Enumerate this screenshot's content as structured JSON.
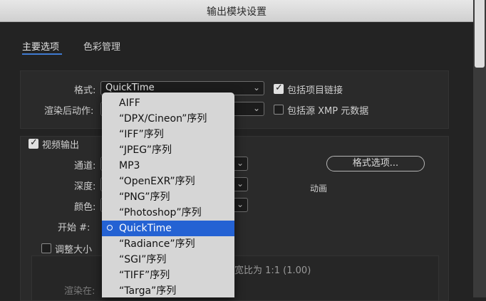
{
  "window": {
    "title": "输出模块设置"
  },
  "tabs": [
    {
      "label": "主要选项"
    },
    {
      "label": "色彩管理"
    }
  ],
  "format": {
    "label": "格式:",
    "value": "QuickTime",
    "include_project_link": "包括项目链接",
    "include_project_link_checked": true
  },
  "post_render": {
    "label": "渲染后动作:",
    "include_xmp": "包括源 XMP 元数据",
    "include_xmp_checked": false
  },
  "video_output": {
    "label": "视频输出",
    "checked": true,
    "channel_label": "通道:",
    "depth_label": "深度:",
    "color_label": "颜色:",
    "start_label": "开始 #:",
    "format_options_button": "格式选项...",
    "animation_text": "动画"
  },
  "resize": {
    "label": "调整大小",
    "checked": false,
    "ratio_text": "宽比为 1:1 (1.00)",
    "render_at_label": "渲染在:"
  },
  "dropdown": {
    "items": [
      "AIFF",
      "“DPX/Cineon”序列",
      "“IFF”序列",
      "“JPEG”序列",
      "MP3",
      "“OpenEXR”序列",
      "“PNG”序列",
      "“Photoshop”序列",
      "QuickTime",
      "“Radiance”序列",
      "“SGI”序列",
      "“TIFF”序列",
      "“Targa”序列"
    ],
    "selected_index": 8
  }
}
